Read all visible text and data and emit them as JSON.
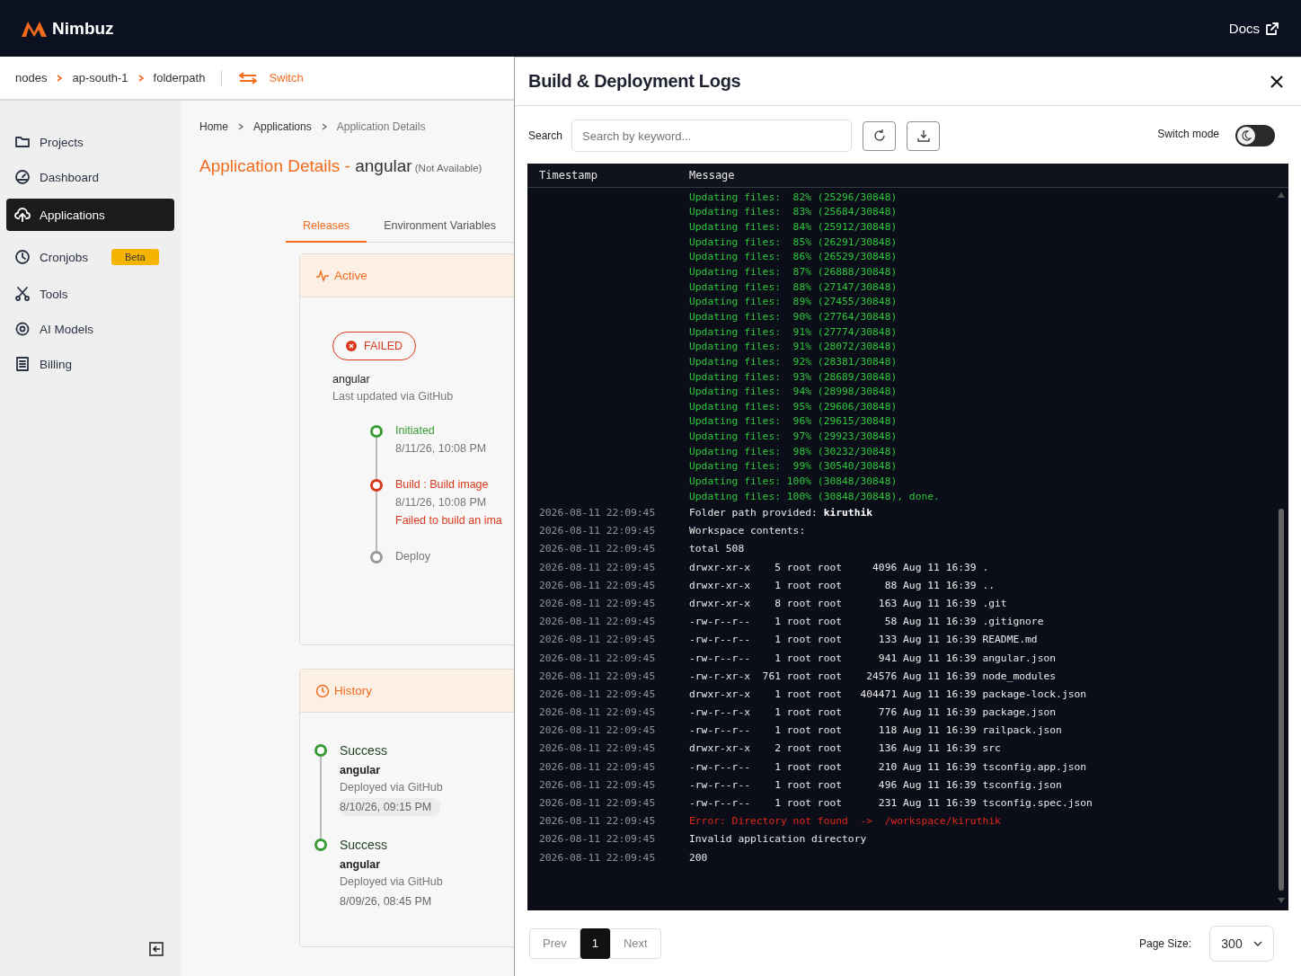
{
  "app": {
    "name": "Nimbuz"
  },
  "topbar": {
    "docs": "Docs"
  },
  "context_bar": {
    "path": [
      "nodes",
      "ap-south-1",
      "folderpath"
    ],
    "switch": "Switch"
  },
  "sidebar": {
    "items": [
      {
        "label": "Projects",
        "selected": false
      },
      {
        "label": "Dashboard",
        "selected": false
      },
      {
        "label": "Applications",
        "selected": true
      },
      {
        "label": "Cronjobs",
        "selected": false,
        "badge": "Beta"
      },
      {
        "label": "Tools",
        "selected": false
      },
      {
        "label": "AI Models",
        "selected": false
      },
      {
        "label": "Billing",
        "selected": false
      }
    ]
  },
  "breadcrumb": [
    "Home",
    "Applications",
    "Application Details"
  ],
  "page_title": {
    "prefix": "Application Details - ",
    "app": "angular",
    "note": "(Not Available)"
  },
  "tabs": [
    {
      "label": "Releases",
      "selected": true
    },
    {
      "label": "Environment Variables",
      "selected": false
    }
  ],
  "active_release": {
    "heading": "Active",
    "status": "FAILED",
    "kind": "failed",
    "app": "angular",
    "source": "Last updated via GitHub",
    "steps": [
      {
        "title": "Initiated",
        "time": "8/11/26, 10:08 PM",
        "kind": "success"
      },
      {
        "title": "Build : Build image",
        "time": "8/11/26, 10:08 PM",
        "error": "Failed to build an ima",
        "kind": "failed"
      },
      {
        "title": "Deploy",
        "kind": "pending"
      }
    ]
  },
  "history": {
    "heading": "History",
    "items": [
      {
        "status": "Success",
        "kind": "success",
        "app": "angular",
        "source": "Deployed via GitHub",
        "time": "8/10/26, 09:15 PM",
        "highlighted": true
      },
      {
        "status": "Success",
        "kind": "success",
        "app": "angular",
        "source": "Deployed via GitHub",
        "time": "8/09/26, 08:45 PM",
        "highlighted": false
      }
    ]
  },
  "logs_modal": {
    "title": "Build & Deployment Logs",
    "search": {
      "label": "Search",
      "placeholder": "Search by keyword..."
    },
    "switch_mode": {
      "label": "Switch mode",
      "on": false
    },
    "columns": [
      "Timestamp",
      "Message"
    ],
    "lines": [
      {
        "kind": "progress",
        "message": "Updating files:  82% (25296/30848)"
      },
      {
        "kind": "progress",
        "message": "Updating files:  83% (25684/30848)"
      },
      {
        "kind": "progress",
        "message": "Updating files:  84% (25912/30848)"
      },
      {
        "kind": "progress",
        "message": "Updating files:  85% (26291/30848)"
      },
      {
        "kind": "progress",
        "message": "Updating files:  86% (26529/30848)"
      },
      {
        "kind": "progress",
        "message": "Updating files:  87% (26888/30848)"
      },
      {
        "kind": "progress",
        "message": "Updating files:  88% (27147/30848)"
      },
      {
        "kind": "progress",
        "message": "Updating files:  89% (27455/30848)"
      },
      {
        "kind": "progress",
        "message": "Updating files:  90% (27764/30848)"
      },
      {
        "kind": "progress",
        "message": "Updating files:  91% (27774/30848)"
      },
      {
        "kind": "progress",
        "message": "Updating files:  91% (28072/30848)"
      },
      {
        "kind": "progress",
        "message": "Updating files:  92% (28381/30848)"
      },
      {
        "kind": "progress",
        "message": "Updating files:  93% (28689/30848)"
      },
      {
        "kind": "progress",
        "message": "Updating files:  94% (28998/30848)"
      },
      {
        "kind": "progress",
        "message": "Updating files:  95% (29606/30848)"
      },
      {
        "kind": "progress",
        "message": "Updating files:  96% (29615/30848)"
      },
      {
        "kind": "progress",
        "message": "Updating files:  97% (29923/30848)"
      },
      {
        "kind": "progress",
        "message": "Updating files:  98% (30232/30848)"
      },
      {
        "kind": "progress",
        "message": "Updating files:  99% (30540/30848)"
      },
      {
        "kind": "progress",
        "message": "Updating files: 100% (30848/30848)"
      },
      {
        "kind": "progress",
        "message": "Updating files: 100% (30848/30848), done."
      },
      {
        "kind": "info",
        "timestamp": "2026-08-11 22:09:45",
        "message": "Folder path provided: **kiruthik**"
      },
      {
        "kind": "info",
        "timestamp": "2026-08-11 22:09:45",
        "message": "Workspace contents:"
      },
      {
        "kind": "info",
        "timestamp": "2026-08-11 22:09:45",
        "message": "total 508"
      },
      {
        "kind": "info",
        "timestamp": "2026-08-11 22:09:45",
        "message": "drwxr-xr-x    5 root root     4096 Aug 11 16:39 ."
      },
      {
        "kind": "info",
        "timestamp": "2026-08-11 22:09:45",
        "message": "drwxr-xr-x    1 root root       88 Aug 11 16:39 .."
      },
      {
        "kind": "info",
        "timestamp": "2026-08-11 22:09:45",
        "message": "drwxr-xr-x    8 root root      163 Aug 11 16:39 .git"
      },
      {
        "kind": "info",
        "timestamp": "2026-08-11 22:09:45",
        "message": "-rw-r--r--    1 root root       58 Aug 11 16:39 .gitignore"
      },
      {
        "kind": "info",
        "timestamp": "2026-08-11 22:09:45",
        "message": "-rw-r--r--    1 root root      133 Aug 11 16:39 README.md"
      },
      {
        "kind": "info",
        "timestamp": "2026-08-11 22:09:45",
        "message": "-rw-r--r--    1 root root      941 Aug 11 16:39 angular.json"
      },
      {
        "kind": "info",
        "timestamp": "2026-08-11 22:09:45",
        "message": "-rw-r-xr-x  761 root root    24576 Aug 11 16:39 node_modules"
      },
      {
        "kind": "info",
        "timestamp": "2026-08-11 22:09:45",
        "message": "drwxr-xr-x    1 root root   404471 Aug 11 16:39 package-lock.json"
      },
      {
        "kind": "info",
        "timestamp": "2026-08-11 22:09:45",
        "message": "-rw-r--r-x    1 root root      776 Aug 11 16:39 package.json"
      },
      {
        "kind": "info",
        "timestamp": "2026-08-11 22:09:45",
        "message": "-rw-r--r--    1 root root      118 Aug 11 16:39 railpack.json"
      },
      {
        "kind": "info",
        "timestamp": "2026-08-11 22:09:45",
        "message": "drwxr-xr-x    2 root root      136 Aug 11 16:39 src"
      },
      {
        "kind": "info",
        "timestamp": "2026-08-11 22:09:45",
        "message": "-rw-r--r--    1 root root      210 Aug 11 16:39 tsconfig.app.json"
      },
      {
        "kind": "info",
        "timestamp": "2026-08-11 22:09:45",
        "message": "-rw-r--r--    1 root root      496 Aug 11 16:39 tsconfig.json"
      },
      {
        "kind": "info",
        "timestamp": "2026-08-11 22:09:45",
        "message": "-rw-r--r--    1 root root      231 Aug 11 16:39 tsconfig.spec.json"
      },
      {
        "kind": "error",
        "timestamp": "2026-08-11 22:09:45",
        "message": "Error: Directory not found  ->  /workspace/kiruthik"
      },
      {
        "kind": "info",
        "timestamp": "2026-08-11 22:09:45",
        "message": "Invalid application directory"
      },
      {
        "kind": "info",
        "timestamp": "2026-08-11 22:09:45",
        "message": "200"
      }
    ],
    "pagination": {
      "prev": "Prev",
      "pages": [
        {
          "label": "1",
          "selected": true
        }
      ],
      "next": "Next"
    },
    "page_size": {
      "label": "Page Size:",
      "value": "300"
    }
  }
}
